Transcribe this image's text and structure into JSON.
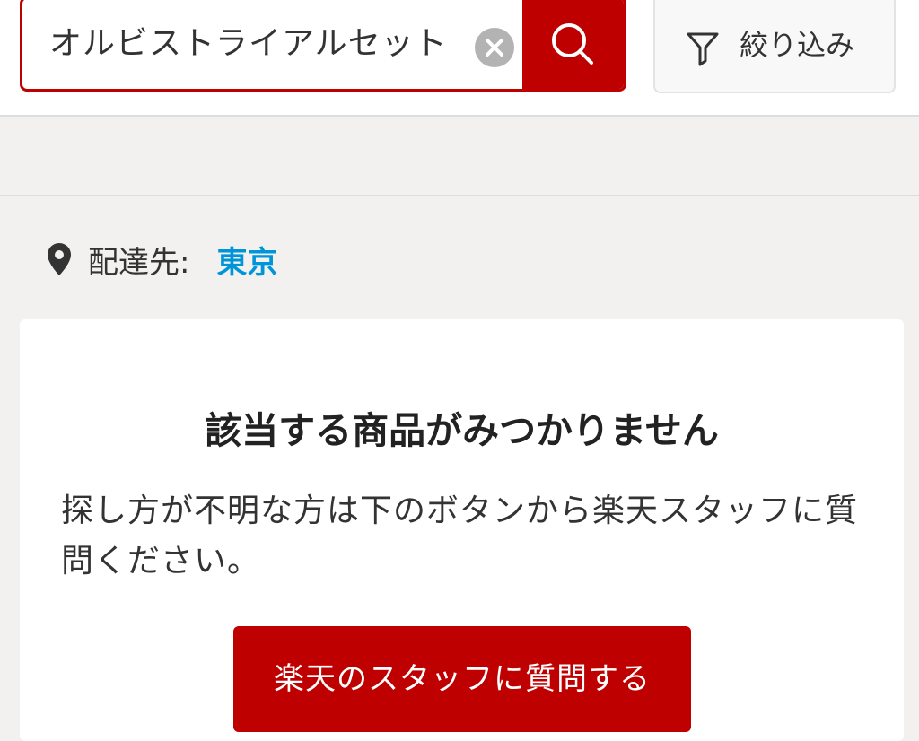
{
  "search": {
    "query": "オルビストライアルセット",
    "clear_icon": "close-circle-icon",
    "search_icon": "magnifier-icon"
  },
  "filter": {
    "label": "絞り込み",
    "icon": "funnel-icon"
  },
  "delivery": {
    "icon": "map-pin-icon",
    "label": "配達先:",
    "value": "東京"
  },
  "no_results": {
    "title": "該当する商品がみつかりません",
    "message": "探し方が不明な方は下のボタンから楽天スタッフに質問ください。",
    "button_label": "楽天のスタッフに質問する"
  },
  "colors": {
    "brand_red": "#bf0000",
    "link_blue": "#0095d9",
    "background": "#f2f1f0"
  }
}
